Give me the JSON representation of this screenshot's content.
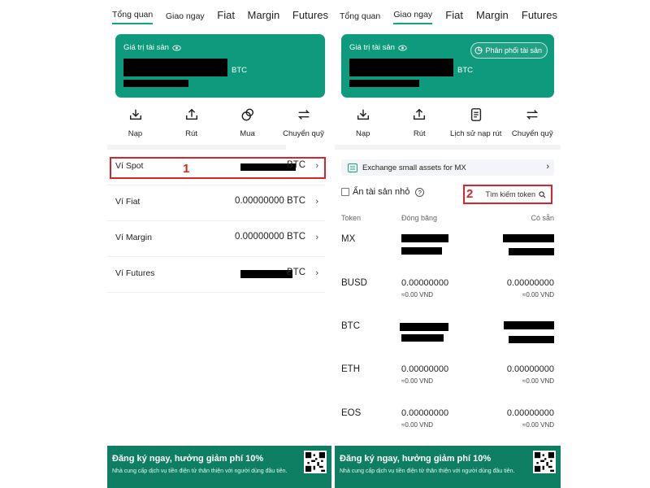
{
  "left": {
    "tabs": [
      "Tổng quan",
      "Giao ngay",
      "Fiat",
      "Margin",
      "Futures"
    ],
    "active_tab": 0,
    "asset_label": "Giá trị tài sản",
    "asset_unit": "BTC",
    "actions": [
      {
        "label": "Nạp",
        "icon": "deposit-icon"
      },
      {
        "label": "Rút",
        "icon": "withdraw-icon"
      },
      {
        "label": "Mua",
        "icon": "buy-icon"
      },
      {
        "label": "Chuyển quỹ",
        "icon": "transfer-icon"
      }
    ],
    "wallets": [
      {
        "name": "Ví Spot",
        "value": "",
        "unit": "BTC"
      },
      {
        "name": "Ví Fiat",
        "value": "0.00000000 BTC",
        "unit": ""
      },
      {
        "name": "Ví Margin",
        "value": "0.00000000 BTC",
        "unit": ""
      },
      {
        "name": "Ví Futures",
        "value": "",
        "unit": "BTC"
      }
    ],
    "highlight_number": "1",
    "promo": {
      "title": "Đăng ký ngay, hưởng giảm phí",
      "percent": "10%",
      "subtitle": "Nhà cung cấp dịch vụ tiền điện tử thân thiện với người dùng đầu tiên."
    }
  },
  "right": {
    "tabs": [
      "Tổng quan",
      "Giao ngay",
      "Fiat",
      "Margin",
      "Futures"
    ],
    "active_tab": 1,
    "asset_label": "Giá trị tài sản",
    "asset_unit": "BTC",
    "distribution_button": "Phân phối tài sản",
    "actions": [
      {
        "label": "Nạp",
        "icon": "deposit-icon"
      },
      {
        "label": "Rút",
        "icon": "withdraw-icon"
      },
      {
        "label": "Lịch sử nạp rút",
        "icon": "history-icon"
      },
      {
        "label": "Chuyển quỹ",
        "icon": "transfer-icon"
      }
    ],
    "exchange_small": "Exchange small assets for MX",
    "hide_small": "Ẩn tài sản nhỏ",
    "search_placeholder": "Tìm kiếm token",
    "highlight_number": "2",
    "columns": {
      "token": "Token",
      "frozen": "Đóng băng",
      "available": "Có sẵn"
    },
    "tokens": [
      {
        "name": "MX",
        "frozen": "",
        "frozen_sub": "",
        "available": "",
        "available_sub": ""
      },
      {
        "name": "BUSD",
        "frozen": "0.00000000",
        "frozen_sub": "≈0.00 VND",
        "available": "0.00000000",
        "available_sub": "≈0.00 VND"
      },
      {
        "name": "BTC",
        "frozen": "",
        "frozen_sub": "",
        "available": "",
        "available_sub": ""
      },
      {
        "name": "ETH",
        "frozen": "0.00000000",
        "frozen_sub": "≈0.00 VND",
        "available": "0.00000000",
        "available_sub": "≈0.00 VND"
      },
      {
        "name": "EOS",
        "frozen": "0.00000000",
        "frozen_sub": "≈0.00 VND",
        "available": "0.00000000",
        "available_sub": "≈0.00 VND"
      }
    ],
    "promo": {
      "title": "Đăng ký ngay, hưởng giảm phí",
      "percent": "10%",
      "subtitle": "Nhà cung cấp dịch vụ tiền điện tử thân thiện với người dùng đầu tiên."
    }
  }
}
